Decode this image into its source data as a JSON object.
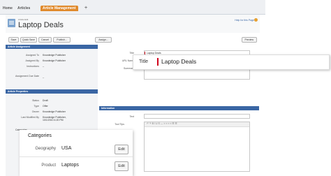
{
  "tabs": [
    {
      "label": "Home"
    },
    {
      "label": "Articles"
    },
    {
      "label": "Article Management"
    }
  ],
  "header": {
    "eyebrow": "Article Edit",
    "title": "Laptop Deals",
    "help": "Help for this Page"
  },
  "toolbar": {
    "save": "Save",
    "quick_save": "Quick Save",
    "cancel": "Cancel",
    "publish": "Publish...",
    "assign": "Assign...",
    "preview": "Preview"
  },
  "article_assignment": {
    "header": "Article Assignment",
    "rows": [
      {
        "label": "Assigned To",
        "value": "Knowledge Publisher"
      },
      {
        "label": "Assigned By",
        "value": "Knowledge Publisher"
      },
      {
        "label": "Instructions",
        "value": "--"
      },
      {
        "label": "Assignment Due Date",
        "value": "--"
      }
    ]
  },
  "article_properties": {
    "header": "Article Properties",
    "rows": [
      {
        "label": "Status",
        "value": "Draft"
      },
      {
        "label": "Type",
        "value": "Offer"
      },
      {
        "label": "Owner",
        "value": "Knowledge Publisher"
      },
      {
        "label": "Last Modified By",
        "value": "Knowledge Publisher, 10/1/2010 4:20 PM"
      }
    ],
    "categories_label": "Categories"
  },
  "form": {
    "title_label": "Title",
    "title_value": "Laptop Deals",
    "url_label": "URL Name",
    "summary_label": "Summary",
    "information_header": "Information",
    "text_label": "Text",
    "tool_tips_label": "Tool Tips"
  },
  "editor_toolbar": "↶ ↷ B I U S — ≡ ≡ ≡ ≡ ☰ ☰",
  "callouts": {
    "title": {
      "label": "Title",
      "value": "Laptop Deals"
    },
    "categories": {
      "title": "Categories",
      "rows": [
        {
          "label": "Geography",
          "value": "USA",
          "button": "Edit"
        },
        {
          "label": "Product",
          "value": "Laptops",
          "button": "Edit"
        }
      ]
    }
  },
  "colors": {
    "accent_tab": "#e08a2c",
    "section_header": "#3a66a4",
    "required_marker": "#d0021b"
  }
}
